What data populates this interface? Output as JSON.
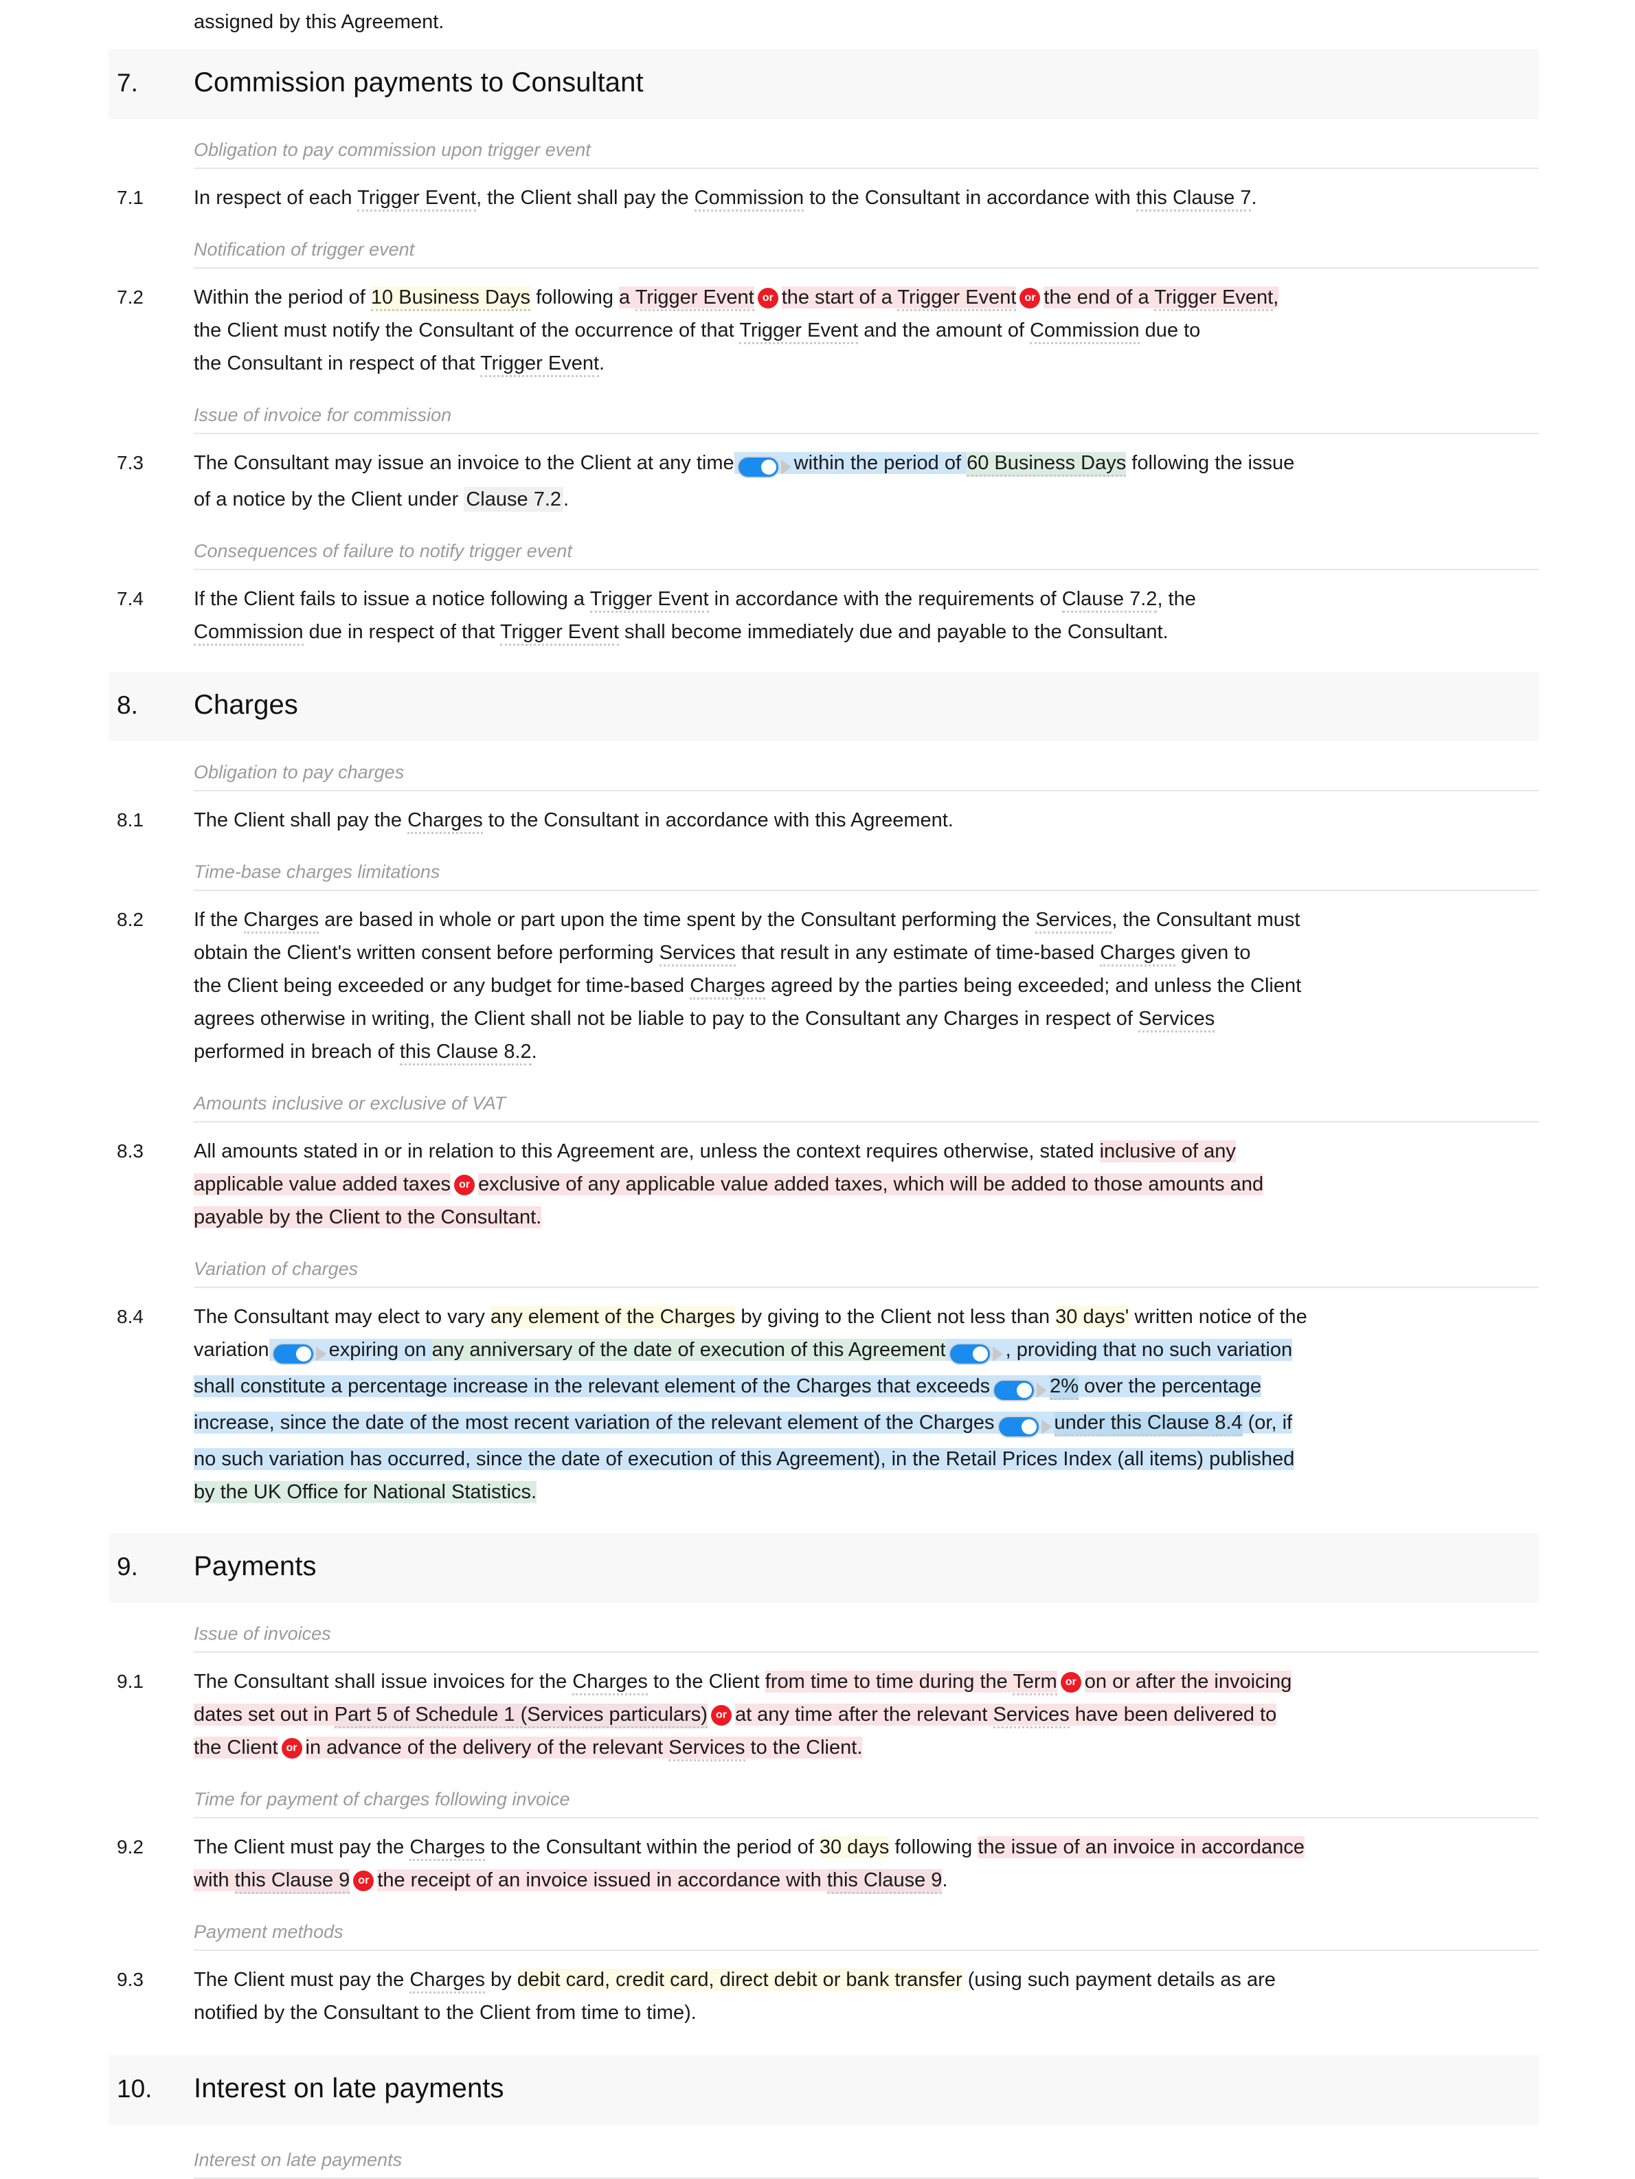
{
  "document": {
    "continuation_text": "assigned by this Agreement.",
    "colors": {
      "heading_band": "#f8f8f8",
      "highlight_yellow": "#fcfbe3",
      "highlight_pink": "#fbe2e4",
      "highlight_blue": "#cde5f9",
      "highlight_green": "#dbece1",
      "or_badge": "#ed1b24",
      "toggle_on": "#1a8cf0",
      "sub_label": "#9b9b9b"
    },
    "or_badge_label": "or"
  },
  "sections": [
    {
      "number": "7.",
      "title": "Commission payments to Consultant",
      "groups": [
        {
          "label": "Obligation to pay commission upon trigger event",
          "clauses": [
            {
              "number": "7.1",
              "plain": "In respect of each Trigger Event, the Client shall pay the Commission to the Consultant in accordance with this Clause 7."
            }
          ]
        },
        {
          "label": "Notification of trigger event",
          "clauses": [
            {
              "number": "7.2",
              "plain": "Within the period of 10 Business Days following a Trigger Event or the start of a Trigger Event or the end of a Trigger Event, the Client must notify the Consultant of the occurrence of that Trigger Event and the amount of Commission due to the Consultant in respect of that Trigger Event."
            }
          ]
        },
        {
          "label": "Issue of invoice for commission",
          "clauses": [
            {
              "number": "7.3",
              "plain": "The Consultant may issue an invoice to the Client at any time within the period of 60 Business Days following the issue of a notice by the Client under Clause 7.2."
            }
          ]
        },
        {
          "label": "Consequences of failure to notify trigger event",
          "clauses": [
            {
              "number": "7.4",
              "plain": "If the Client fails to issue a notice following a Trigger Event in accordance with the requirements of Clause 7.2, the Commission due in respect of that Trigger Event shall become immediately due and payable to the Consultant."
            }
          ]
        }
      ]
    },
    {
      "number": "8.",
      "title": "Charges",
      "groups": [
        {
          "label": "Obligation to pay charges",
          "clauses": [
            {
              "number": "8.1",
              "plain": "The Client shall pay the Charges to the Consultant in accordance with this Agreement."
            }
          ]
        },
        {
          "label": "Time-base charges limitations",
          "clauses": [
            {
              "number": "8.2",
              "plain": "If the Charges are based in whole or part upon the time spent by the Consultant performing the Services, the Consultant must obtain the Client's written consent before performing Services that result in any estimate of time-based Charges given to the Client being exceeded or any budget for time-based Charges agreed by the parties being exceeded; and unless the Client agrees otherwise in writing, the Client shall not be liable to pay to the Consultant any Charges in respect of Services performed in breach of this Clause 8.2."
            }
          ]
        },
        {
          "label": "Amounts inclusive or exclusive of VAT",
          "clauses": [
            {
              "number": "8.3",
              "plain": "All amounts stated in or in relation to this Agreement are, unless the context requires otherwise, stated inclusive of any applicable value added taxes or exclusive of any applicable value added taxes, which will be added to those amounts and payable by the Client to the Consultant."
            }
          ]
        },
        {
          "label": "Variation of charges",
          "clauses": [
            {
              "number": "8.4",
              "plain": "The Consultant may elect to vary any element of the Charges by giving to the Client not less than 30 days' written notice of the variation expiring on any anniversary of the date of execution of this Agreement, providing that no such variation shall constitute a percentage increase in the relevant element of the Charges that exceeds 2% over the percentage increase, since the date of the most recent variation of the relevant element of the Charges under this Clause 8.4 (or, if no such variation has occurred, since the date of execution of this Agreement), in the Retail Prices Index (all items) published by the UK Office for National Statistics."
            }
          ]
        }
      ]
    },
    {
      "number": "9.",
      "title": "Payments",
      "groups": [
        {
          "label": "Issue of invoices",
          "clauses": [
            {
              "number": "9.1",
              "plain": "The Consultant shall issue invoices for the Charges to the Client from time to time during the Term or on or after the invoicing dates set out in Part 5 of Schedule 1 (Services particulars) or at any time after the relevant Services have been delivered to the Client or in advance of the delivery of the relevant Services to the Client."
            }
          ]
        },
        {
          "label": "Time for payment of charges following invoice",
          "clauses": [
            {
              "number": "9.2",
              "plain": "The Client must pay the Charges to the Consultant within the period of 30 days following the issue of an invoice in accordance with this Clause 9 or the receipt of an invoice issued in accordance with this Clause 9."
            }
          ]
        },
        {
          "label": "Payment methods",
          "clauses": [
            {
              "number": "9.3",
              "plain": "The Client must pay the Charges by debit card, credit card, direct debit or bank transfer (using such payment details as are notified by the Consultant to the Client from time to time)."
            }
          ]
        }
      ]
    },
    {
      "number": "10.",
      "title": "Interest on late payments",
      "groups": [
        {
          "label": "Interest on late payments",
          "clauses": []
        }
      ]
    }
  ],
  "fragments": {
    "c71": {
      "a": "In respect of each ",
      "trigger_event": "Trigger Event",
      "b": ", the Client shall pay the ",
      "commission": "Commission",
      "c": " to the Consultant in accordance with ",
      "clause7": "this Clause 7",
      "d": "."
    },
    "c72": {
      "a": "Within the period of ",
      "days10": "10 Business Days",
      "b": " following ",
      "opt1": "a Trigger Event",
      "opt1_term": "Trigger Event",
      "opt1_pre": "a ",
      "opt2_pre": "the start of a ",
      "opt2_term": "Trigger Event",
      "opt3_pre": "the end of a ",
      "opt3_term": "Trigger Event",
      "opt3_post": ",",
      "c": "the Client must notify the Consultant of the occurrence of that ",
      "te2": "Trigger Event",
      "d": " and the amount of ",
      "commission": "Commission",
      "e": " due to",
      "f": "the Consultant in respect of that ",
      "te3": "Trigger Event",
      "g": "."
    },
    "c73": {
      "a": "The Consultant may issue an invoice to the Client at any time",
      "b": "within the period of ",
      "days60": "60 Business Days",
      "c": " following the issue",
      "d": "of a notice by the Client under ",
      "clause72": "Clause 7.2",
      "e": "."
    },
    "c74": {
      "a": "If the Client fails to issue a notice following a ",
      "te": "Trigger Event",
      "b": " in accordance with the requirements of ",
      "clause72": "Clause 7.2",
      "c": ", the",
      "commission": "Commission",
      "d": " due in respect of that ",
      "te2": "Trigger Event",
      "e": " shall become immediately due and payable to the Consultant."
    },
    "c81": {
      "a": "The Client shall pay the ",
      "charges": "Charges",
      "b": " to the Consultant in accordance with this Agreement."
    },
    "c82": {
      "l1a": "If the ",
      "charges1": "Charges",
      "l1b": " are based in whole or part upon the time spent by the Consultant performing the ",
      "services1": "Services",
      "l1c": ", the Consultant must",
      "l2a": "obtain the Client's written consent before performing ",
      "services2": "Services",
      "l2b": " that result in any estimate of time-based ",
      "charges2": "Charges",
      "l2c": " given to",
      "l3a": "the Client being exceeded or any budget for time-based ",
      "charges3": "Charges",
      "l3b": " agreed by the parties being exceeded; and unless the Client",
      "l4a": "agrees otherwise in writing, the Client shall not be liable to pay to the Consultant any Charges in respect of ",
      "services3": "Services",
      "l5a": "performed in breach of ",
      "clause82": "this Clause 8.2",
      "l5b": "."
    },
    "c83": {
      "a": "All amounts stated in or in relation to this Agreement are, unless the context requires otherwise, stated ",
      "opt1a": "inclusive of any",
      "opt1b": "applicable value added taxes",
      "opt2a": "exclusive of any applicable value added taxes, which will be added to those amounts and",
      "opt2b": "payable by the Client to the Consultant."
    },
    "c84": {
      "a": "The Consultant may elect to vary ",
      "elem": "any element of the Charges",
      "b": " by giving to the Client not less than ",
      "days30": "30 days'",
      "c": " written notice of the",
      "d": "variation",
      "e": "expiring on ",
      "anniv": "any anniversary of the date of execution of this Agreement",
      "f": ", providing that no such variation",
      "g": "shall constitute a percentage increase in the relevant element of the Charges that exceeds",
      "pct": "2%",
      "h": " over the percentage",
      "i": "increase, since the date of the most recent variation of the relevant element of the Charges",
      "j": "under this Clause 8.4",
      "k": " (or, if",
      "l": "no such variation has occurred, since the date of execution of this Agreement), in the Retail Prices Index (all items) published",
      "m": "by the UK Office for National Statistics."
    },
    "c91": {
      "a": "The Consultant shall issue invoices for the ",
      "charges": "Charges",
      "b": " to the Client ",
      "opt1": "from time to time during the ",
      "term": "Term",
      "opt2a": "on or after the invoicing",
      "opt2b": "dates set out in ",
      "part5": "Part 5 of Schedule 1 (Services particulars)",
      "opt3a": "at any time after the relevant ",
      "services1": "Services",
      "opt3b": " have been delivered to",
      "opt3c": "the Client",
      "opt4a": "in advance of the delivery of the relevant ",
      "services2": "Services",
      "opt4b": " to the Client."
    },
    "c92": {
      "a": "The Client must pay the ",
      "charges": "Charges",
      "b": " to the Consultant within the period of ",
      "days30": "30 days",
      "c": " following ",
      "opt1a": "the issue of an invoice in accordance",
      "opt1b": "with ",
      "clause9a": "this Clause 9",
      "opt2a": "the receipt of an invoice issued in accordance with ",
      "clause9b": "this Clause 9",
      "opt2b": "."
    },
    "c93": {
      "a": "The Client must pay the ",
      "charges": "Charges",
      "b": " by ",
      "methods": "debit card, credit card, direct debit or bank transfer",
      "c": " (using such payment details as are",
      "d": "notified by the Consultant to the Client from time to time)."
    }
  }
}
